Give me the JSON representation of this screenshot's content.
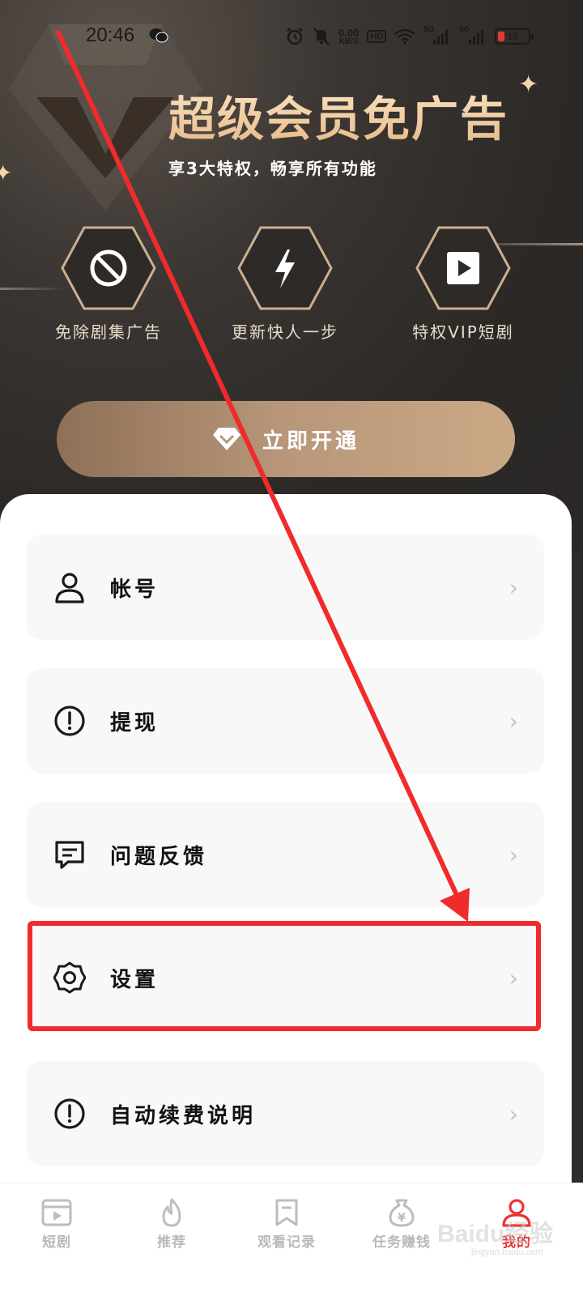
{
  "status_bar": {
    "time": "20:46",
    "net_speed_value": "0.00",
    "net_speed_unit": "KB/S",
    "hd": "HD",
    "signal1": "5G",
    "signal2": "5G",
    "battery": "18"
  },
  "vip": {
    "title": "超级会员免广告",
    "subtitle": "享3大特权，畅享所有功能",
    "perks": [
      {
        "label": "免除剧集广告",
        "icon": "no-ads-icon"
      },
      {
        "label": "更新快人一步",
        "icon": "lightning-icon"
      },
      {
        "label": "特权VIP短剧",
        "icon": "play-icon"
      }
    ],
    "cta_label": "立即开通"
  },
  "menu": [
    {
      "label": "帐号",
      "icon": "user-icon"
    },
    {
      "label": "提现",
      "icon": "exclamation-circle-icon"
    },
    {
      "label": "问题反馈",
      "icon": "message-icon"
    },
    {
      "label": "设置",
      "icon": "gear-icon"
    },
    {
      "label": "自动续费说明",
      "icon": "exclamation-circle-icon"
    }
  ],
  "bottom_nav": {
    "active": "我的",
    "tabs": [
      {
        "label": "短剧",
        "icon": "video-icon"
      },
      {
        "label": "推荐",
        "icon": "flame-icon"
      },
      {
        "label": "观看记录",
        "icon": "bookmark-icon"
      },
      {
        "label": "任务赚钱",
        "icon": "money-bag-icon"
      },
      {
        "label": "我的",
        "icon": "user-icon"
      }
    ]
  },
  "watermark": {
    "text": "Baidu经验",
    "sub": "jingyan.baidu.com"
  },
  "colors": {
    "gold": "#e7b987",
    "cta": "#b8977a",
    "annotation_red": "#ef2b2b",
    "active_tab": "#e93434"
  }
}
